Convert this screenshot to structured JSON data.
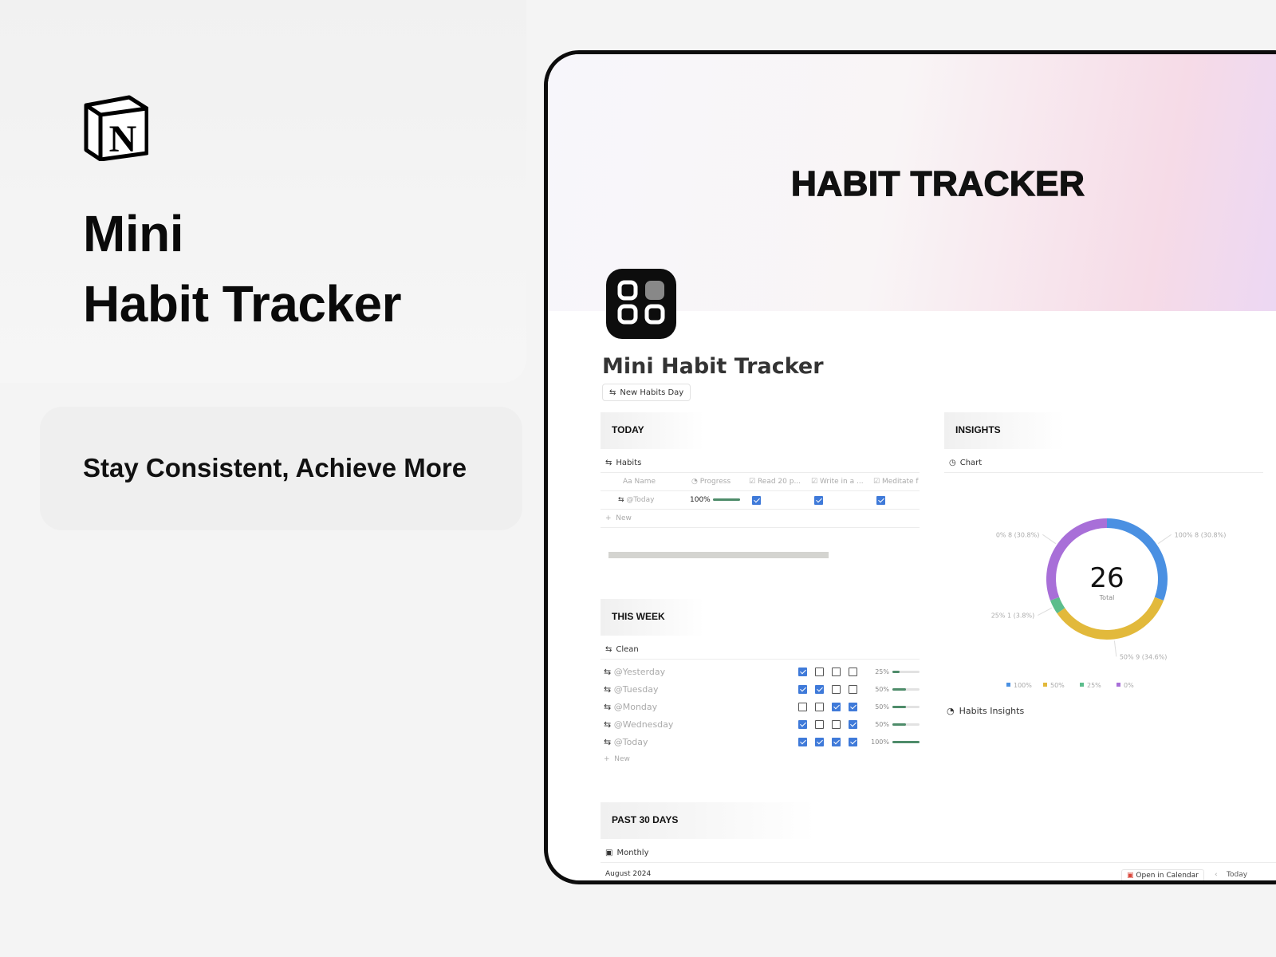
{
  "promo": {
    "title_line1": "Mini",
    "title_line2": "Habit Tracker",
    "tagline": "Stay Consistent, Achieve More",
    "logo": "notion-logo"
  },
  "page": {
    "cover_title": "HABIT TRACKER",
    "icon": "grid-apps-icon",
    "title": "Mini Habit Tracker",
    "new_day_button": "New Habits Day",
    "today": {
      "heading": "TODAY",
      "view": "Habits",
      "columns": [
        "Name",
        "Progress",
        "Read 20 p...",
        "Write in a ...",
        "Meditate f"
      ],
      "rows": [
        {
          "name": "@Today",
          "progress": "100%",
          "progress_value": 1.0,
          "checks": [
            true,
            true,
            true
          ]
        }
      ],
      "new_label": "New"
    },
    "week": {
      "heading": "THIS WEEK",
      "view": "Clean",
      "rows": [
        {
          "name": "@Yesterday",
          "checks": [
            true,
            false,
            false,
            false
          ],
          "progress": "25%",
          "progress_value": 0.25
        },
        {
          "name": "@Tuesday",
          "checks": [
            true,
            true,
            false,
            false
          ],
          "progress": "50%",
          "progress_value": 0.5
        },
        {
          "name": "@Monday",
          "checks": [
            false,
            false,
            true,
            true
          ],
          "progress": "50%",
          "progress_value": 0.5
        },
        {
          "name": "@Wednesday",
          "checks": [
            true,
            false,
            false,
            true
          ],
          "progress": "50%",
          "progress_value": 0.5
        },
        {
          "name": "@Today",
          "checks": [
            true,
            true,
            true,
            true
          ],
          "progress": "100%",
          "progress_value": 1.0
        }
      ],
      "new_label": "New"
    },
    "past": {
      "heading": "PAST 30 DAYS",
      "view": "Monthly",
      "month": "August 2024",
      "open_calendar": "Open in Calendar",
      "today": "Today"
    },
    "insights": {
      "heading": "INSIGHTS",
      "view": "Chart",
      "link": "Habits Insights"
    }
  },
  "chart_data": {
    "type": "pie",
    "variant": "donut",
    "center_value": "26",
    "center_label": "Total",
    "categories": [
      "100%",
      "50%",
      "25%",
      "0%"
    ],
    "values": [
      8,
      9,
      1,
      8
    ],
    "labels": [
      "100% 8 (30.8%)",
      "50% 9 (34.6%)",
      "25% 1 (3.8%)",
      "0% 8 (30.8%)"
    ],
    "colors": [
      "#4a90e2",
      "#e2b93b",
      "#5cbd8c",
      "#a86fd8"
    ],
    "legend": "bottom"
  }
}
